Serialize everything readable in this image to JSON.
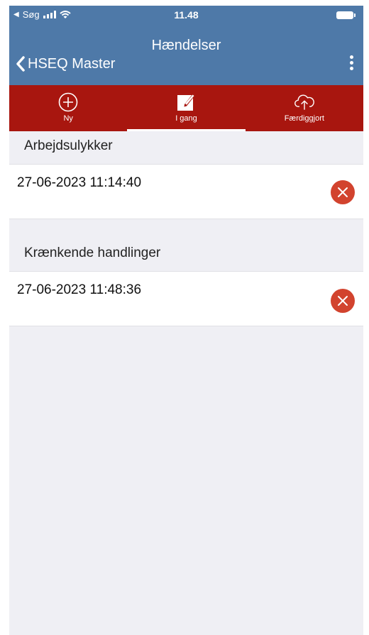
{
  "status_bar": {
    "back_app_label": "Søg",
    "time": "11.48"
  },
  "nav": {
    "title": "Hændelser",
    "back_label": "HSEQ Master"
  },
  "tabs": [
    {
      "label": "Ny",
      "icon": "plus-circle-icon",
      "active": false
    },
    {
      "label": "I gang",
      "icon": "edit-icon",
      "active": true
    },
    {
      "label": "Færdiggjort",
      "icon": "cloud-upload-icon",
      "active": false
    }
  ],
  "sections": [
    {
      "title": "Arbejdsulykker",
      "items": [
        {
          "datetime": "27-06-2023 11:14:40"
        }
      ]
    },
    {
      "title": "Krænkende handlinger",
      "items": [
        {
          "datetime": "27-06-2023 11:48:36"
        }
      ]
    }
  ],
  "colors": {
    "nav_blue": "#4e79a8",
    "tab_red": "#a8160f",
    "delete_red": "#d2432e",
    "background": "#efeff4"
  }
}
